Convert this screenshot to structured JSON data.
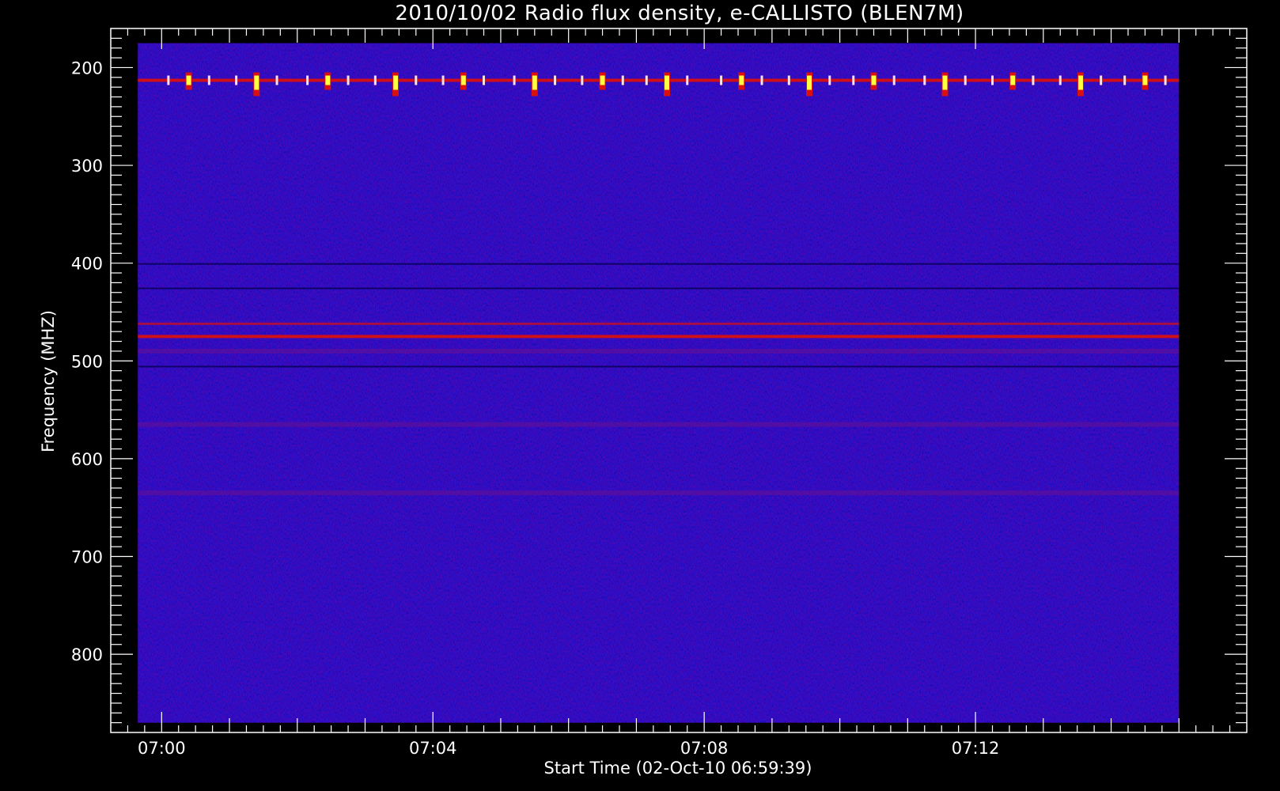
{
  "chart_data": {
    "type": "heatmap",
    "title": "2010/10/02  Radio flux density, e-CALLISTO (BLEN7M)",
    "xlabel": "Start Time (02-Oct-10 06:59:39)",
    "ylabel": "Frequency (MHZ)",
    "x_start_minutes": -0.35,
    "x_end_minutes": 15,
    "x_axis_range_minutes": [
      -0.75,
      16
    ],
    "y_range_mhz": [
      175,
      870
    ],
    "y_axis_range_mhz": [
      160,
      880
    ],
    "y_inverted": true,
    "x_ticks": [
      {
        "minute": 0,
        "label": "07:00"
      },
      {
        "minute": 4,
        "label": "07:04"
      },
      {
        "minute": 8,
        "label": "07:08"
      },
      {
        "minute": 12,
        "label": "07:12"
      }
    ],
    "y_ticks": [
      {
        "mhz": 200,
        "label": "200"
      },
      {
        "mhz": 300,
        "label": "300"
      },
      {
        "mhz": 400,
        "label": "400"
      },
      {
        "mhz": 500,
        "label": "500"
      },
      {
        "mhz": 600,
        "label": "600"
      },
      {
        "mhz": 700,
        "label": "700"
      },
      {
        "mhz": 800,
        "label": "800"
      }
    ],
    "colors": {
      "background": "#000000",
      "low": "#1a10d8",
      "high": "#ffff40",
      "mid": "#d81010"
    },
    "bands": [
      {
        "mhz": 213,
        "intensity": "high",
        "note": "periodic bursts"
      },
      {
        "mhz": 462,
        "intensity": "medium"
      },
      {
        "mhz": 475,
        "intensity": "high"
      },
      {
        "mhz": 490,
        "intensity": "low"
      },
      {
        "mhz": 565,
        "intensity": "low"
      },
      {
        "mhz": 635,
        "intensity": "low"
      }
    ],
    "burst_minutes": [
      0.4,
      1.4,
      2.45,
      3.45,
      4.45,
      5.5,
      6.5,
      7.45,
      8.55,
      9.55,
      10.5,
      11.55,
      12.55,
      13.55,
      14.5
    ],
    "grid": false,
    "legend": "none"
  }
}
